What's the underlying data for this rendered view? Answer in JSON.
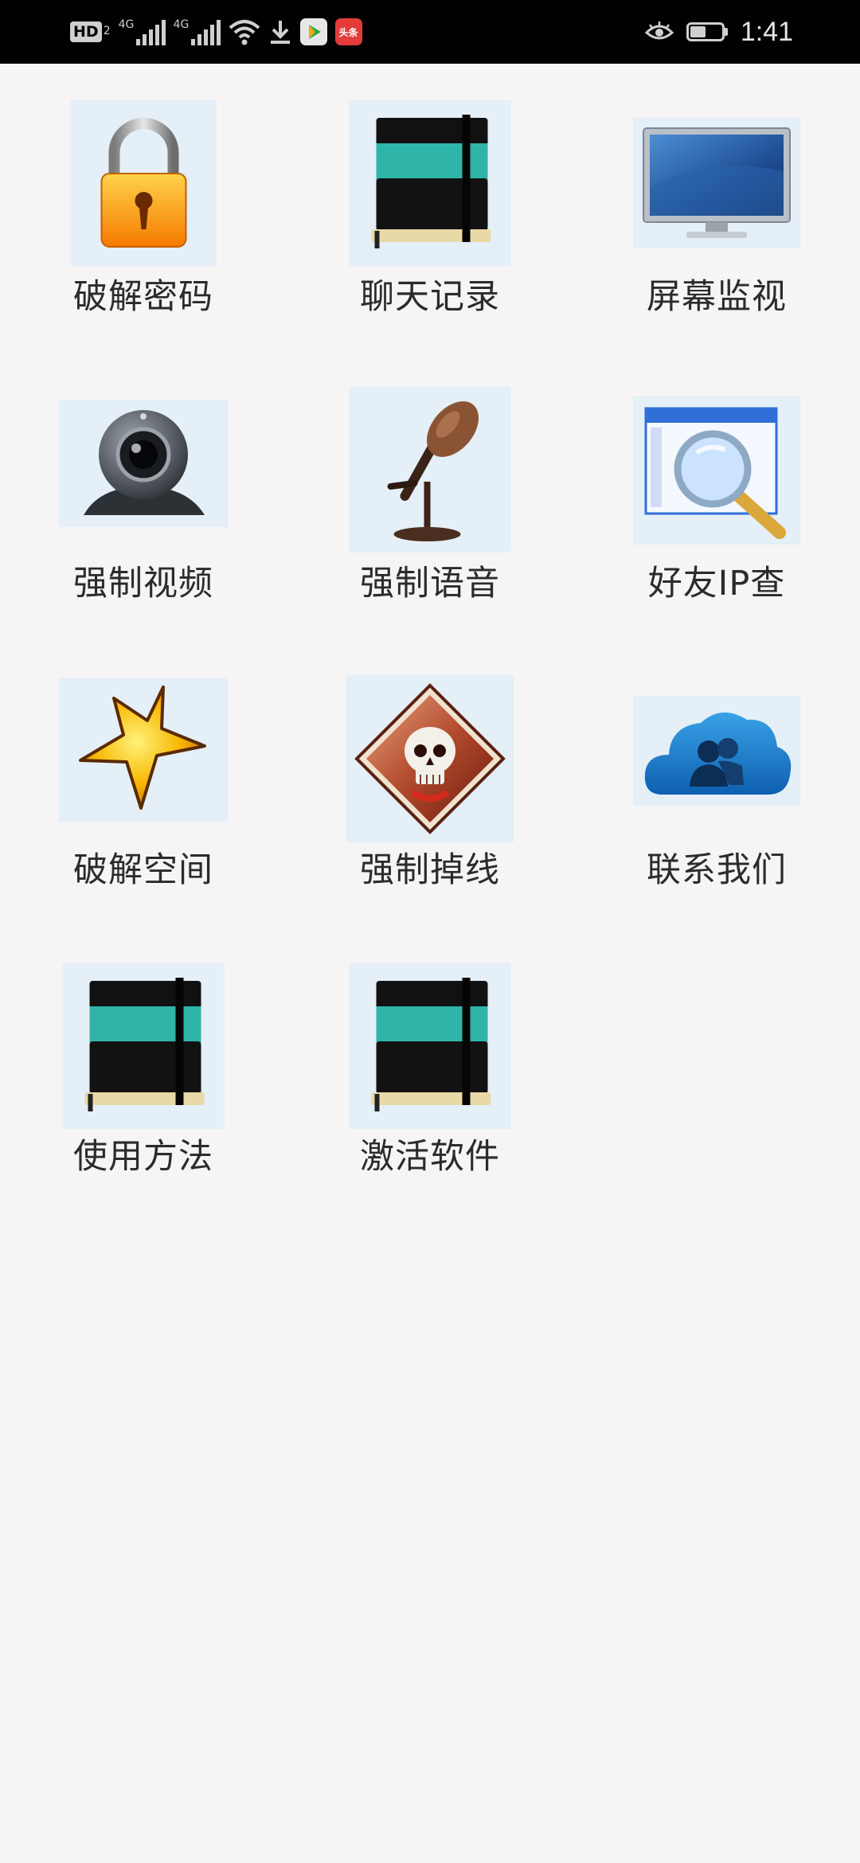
{
  "status_bar": {
    "hd_label": "HD",
    "hd_sub": "2",
    "net1": "4G",
    "net2": "4G",
    "news_app_label": "头条",
    "time": "1:41"
  },
  "grid": {
    "items": [
      {
        "label": "破解密码",
        "icon": "lock-icon"
      },
      {
        "label": "聊天记录",
        "icon": "notebook-icon"
      },
      {
        "label": "屏幕监视",
        "icon": "monitor-icon"
      },
      {
        "label": "强制视频",
        "icon": "webcam-icon"
      },
      {
        "label": "强制语音",
        "icon": "microphone-icon"
      },
      {
        "label": "好友IP查",
        "icon": "magnifier-icon"
      },
      {
        "label": "破解空间",
        "icon": "star-icon"
      },
      {
        "label": "强制掉线",
        "icon": "skull-icon"
      },
      {
        "label": "联系我们",
        "icon": "cloud-contacts-icon"
      },
      {
        "label": "使用方法",
        "icon": "notebook-icon"
      },
      {
        "label": "激活软件",
        "icon": "notebook-icon"
      }
    ]
  }
}
